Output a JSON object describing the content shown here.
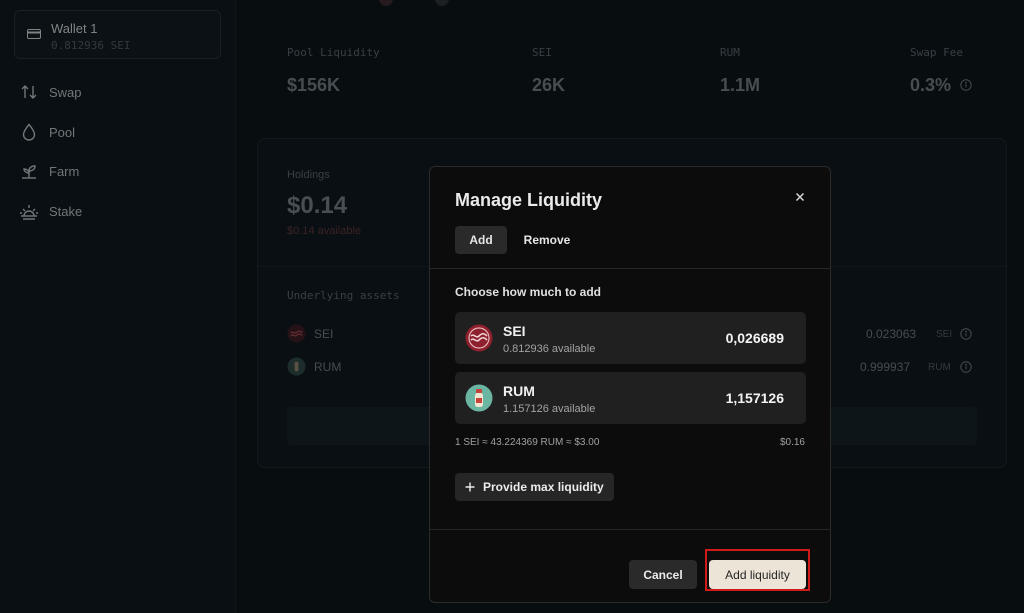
{
  "sidebar": {
    "wallet": {
      "name": "Wallet 1",
      "balance": "0.812936 SEI"
    },
    "items": [
      {
        "label": "Swap",
        "icon": "swap-icon"
      },
      {
        "label": "Pool",
        "icon": "droplet-icon"
      },
      {
        "label": "Farm",
        "icon": "sprout-icon"
      },
      {
        "label": "Stake",
        "icon": "sunrise-icon"
      }
    ]
  },
  "stats": [
    {
      "label": "Pool Liquidity",
      "value": "$156K"
    },
    {
      "label": "SEI",
      "value": "26K"
    },
    {
      "label": "RUM",
      "value": "1.1M"
    },
    {
      "label": "Swap Fee",
      "value": "0.3%"
    }
  ],
  "holdings": {
    "label": "Holdings",
    "value": "$0.14",
    "available": "$0.14 available",
    "underlying_label": "Underlying assets",
    "assets": [
      {
        "name": "SEI",
        "amount": "0.023063",
        "unit": "SEI"
      },
      {
        "name": "RUM",
        "amount": "0.999937",
        "unit": "RUM"
      }
    ]
  },
  "modal": {
    "title": "Manage Liquidity",
    "tabs": {
      "add": "Add",
      "remove": "Remove"
    },
    "choose_label": "Choose how much to add",
    "assets": [
      {
        "name": "SEI",
        "available": "0.812936 available",
        "value": "0,026689"
      },
      {
        "name": "RUM",
        "available": "1.157126 available",
        "value": "1,157126"
      }
    ],
    "rate": "1 SEI ≈ 43.224369 RUM ≈ $3.00",
    "total": "$0.16",
    "max_button": "Provide max liquidity",
    "cancel_button": "Cancel",
    "add_button": "Add liquidity"
  },
  "colors": {
    "background": "#0d1419",
    "modal_background": "#0c0c0c",
    "primary_button": "#ece4d7",
    "highlight_border": "#d11a1a"
  }
}
